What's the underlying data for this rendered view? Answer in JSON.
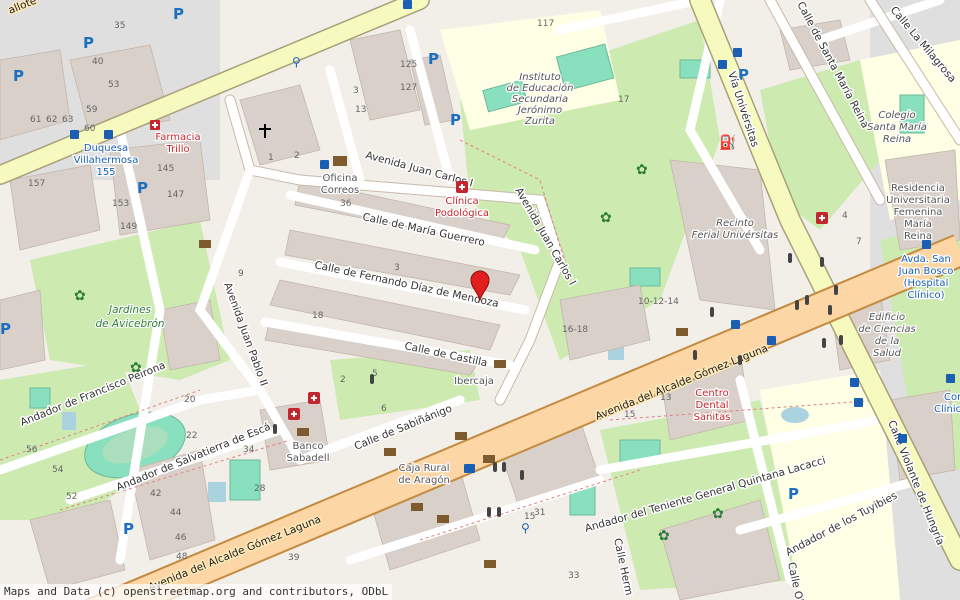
{
  "streets": {
    "avenida_juan_carlos_i": "Avenida Juan Carlos I",
    "avenida_juan_carlos_i_2": "Avenida Juan Carlos I",
    "calle_maria_guerrero": "Calle de María Guerrero",
    "calle_fernando_diaz_mendoza": "Calle de Fernando Díaz de Mendoza",
    "calle_castilla": "Calle de Castilla",
    "avenida_juan_pablo_ii": "Avenida Juan Pablo II",
    "calle_sabinanigo": "Calle de Sabiñánigo",
    "avenida_alcalde_gomez_laguna": "Avenida del Alcalde Gómez Laguna",
    "avenida_alcalde_gomez_laguna_2": "Avenida del Alcalde Gómez Laguna",
    "andador_francisco_peirona": "Andador de Francisco Peirona",
    "andador_salvatierra": "Andador de Salvatierra de Escá",
    "andador_teniente_general": "Andador del Teniente General Quintana Lacacci",
    "andador_tuyibies": "Andador de los Tuyibies",
    "via_universitas": "Vía Univérsitas",
    "calle_santa_maria_reina": "Calle de Santa María Reina",
    "calle_la_milagrosa": "Calle La Milagrosa",
    "calle_violante_hungria": "Calle Violante de Hungría",
    "calle_herm": "Calle Herm",
    "calle_ol": "Calle Ol",
    "calle_allote": "allote"
  },
  "parks": {
    "jardines_avicebron": [
      "Jardines",
      "de Avicebrón"
    ]
  },
  "pois": {
    "farmacia_trillo": [
      "Farmacia",
      "Trillo"
    ],
    "oficina_correos": [
      "Oficina",
      "Correos"
    ],
    "clinica_podologica": [
      "Clínica",
      "Podológica"
    ],
    "instituto": [
      "Instituto",
      "de Educación",
      "Secundaria",
      "Jerónimo",
      "Zurita"
    ],
    "recinto_ferial": [
      "Recinto",
      "Ferial Univérsitas"
    ],
    "colegio_santa_maria": [
      "Colegio",
      "Santa María",
      "Reina"
    ],
    "residencia": [
      "Residencia",
      "Universitaria",
      "Femenina",
      "María",
      "Reina"
    ],
    "avda_san_juan_bosco": [
      "Avda. San",
      "Juan Bosco",
      "(Hospital",
      "Clínico)"
    ],
    "edificio_ciencias_salud": [
      "Edificio",
      "de Ciencias",
      "de la",
      "Salud"
    ],
    "ibercaja": "Ibercaja",
    "banco_sabadell": [
      "Banco",
      "Sabadell"
    ],
    "caja_rural": [
      "Caja Rural",
      "de Aragón"
    ],
    "centro_dental": [
      "Centro",
      "Dental",
      "Sanitas"
    ],
    "consul": [
      "Consul",
      "Clínic"
    ],
    "duquesa_villahermosa": [
      "Duquesa",
      "Villahermosa",
      "155"
    ]
  },
  "house_numbers": [
    "117",
    "125",
    "127",
    "3",
    "13",
    "17",
    "15",
    "40",
    "59",
    "61",
    "62",
    "63",
    "60",
    "53",
    "49",
    "36",
    "145",
    "147",
    "157",
    "153",
    "149",
    "35",
    "9",
    "18",
    "10-12-14",
    "16-18",
    "20",
    "22",
    "34",
    "42",
    "44",
    "48",
    "52",
    "54",
    "56",
    "46",
    "28",
    "31",
    "33",
    "39",
    "6",
    "5",
    "2",
    "1",
    "4",
    "3",
    "13",
    "15",
    "2",
    "7"
  ],
  "icons": {
    "parking": "P",
    "place_of_worship": "church-cross-icon",
    "marker": "location-pin-icon"
  },
  "colors": {
    "primary_road": "#fcd6a4",
    "primary_road_casing": "#c38a40",
    "secondary_road": "#f7fabf",
    "residential": "#ffffff",
    "building": "#d9d0c9",
    "park": "#cdebb0",
    "pitch": "#88e0be",
    "water": "#aad3df",
    "school": "#ffffe5",
    "health": "#c4262e",
    "marker": "#e11d1d"
  },
  "attribution": "Maps and Data (c) openstreetmap.org and contributors, ODbL"
}
